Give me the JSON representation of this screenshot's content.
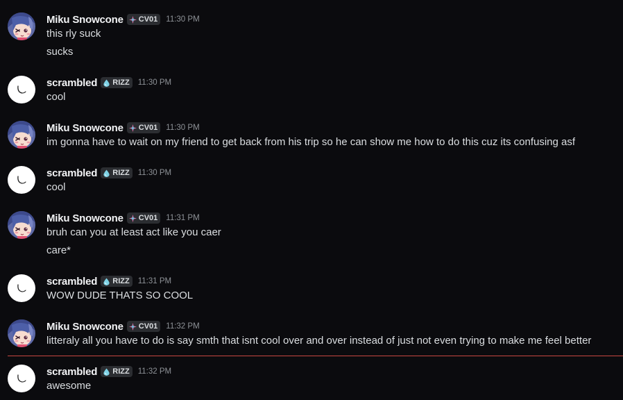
{
  "theme": {
    "background": "#0b0b0e",
    "text": "#dbdee1",
    "username": "#f2f3f5",
    "timestamp": "#8e9297",
    "tag_background": "#2b2d31",
    "new_messages_divider": "#c94842"
  },
  "messages": [
    {
      "author": "Miku Snowcone",
      "tag": "CV01",
      "tag_icon": "sparkle-icon",
      "avatar": "anime-avatar",
      "time": "11:30 PM",
      "lines": [
        "this rly suck",
        "sucks"
      ]
    },
    {
      "author": "scrambled",
      "tag": "RIZZ",
      "tag_icon": "droplet-icon",
      "avatar": "white-ghost-avatar",
      "time": "11:30 PM",
      "lines": [
        "cool"
      ]
    },
    {
      "author": "Miku Snowcone",
      "tag": "CV01",
      "tag_icon": "sparkle-icon",
      "avatar": "anime-avatar",
      "time": "11:30 PM",
      "lines": [
        "im gonna have to wait on my friend to get back from his trip so he can show me how to do this cuz its confusing asf"
      ]
    },
    {
      "author": "scrambled",
      "tag": "RIZZ",
      "tag_icon": "droplet-icon",
      "avatar": "white-ghost-avatar",
      "time": "11:30 PM",
      "lines": [
        "cool"
      ]
    },
    {
      "author": "Miku Snowcone",
      "tag": "CV01",
      "tag_icon": "sparkle-icon",
      "avatar": "anime-avatar",
      "time": "11:31 PM",
      "lines": [
        "bruh can you at least act like you caer",
        "care*"
      ]
    },
    {
      "author": "scrambled",
      "tag": "RIZZ",
      "tag_icon": "droplet-icon",
      "avatar": "white-ghost-avatar",
      "time": "11:31 PM",
      "lines": [
        "WOW DUDE THATS SO COOL"
      ]
    },
    {
      "author": "Miku Snowcone",
      "tag": "CV01",
      "tag_icon": "sparkle-icon",
      "avatar": "anime-avatar",
      "time": "11:32 PM",
      "lines": [
        "litteraly all you have to do is say smth that isnt cool over and over instead of just not even trying to make me feel better"
      ]
    },
    {
      "author": "scrambled",
      "tag": "RIZZ",
      "tag_icon": "droplet-icon",
      "avatar": "white-ghost-avatar",
      "time": "11:32 PM",
      "lines": [
        "awesome"
      ]
    }
  ]
}
